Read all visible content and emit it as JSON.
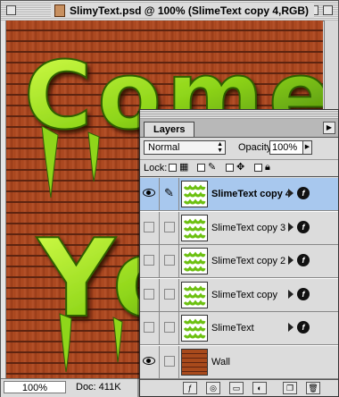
{
  "window": {
    "title": "SlimyText.psd @ 100% (SlimeText copy 4,RGB)"
  },
  "canvas": {
    "art_text_lines": [
      "Come",
      "You"
    ],
    "colors": {
      "brick": "#a7441c",
      "mortar": "#5e2410",
      "slime": "#8fd61a"
    }
  },
  "statusbar": {
    "zoom": "100%",
    "doc_info": "Doc: 411K"
  },
  "layers_palette": {
    "tab_label": "Layers",
    "blend_mode": "Normal",
    "opacity_label": "Opacity:",
    "opacity_value": "100%",
    "lock_label": "Lock:",
    "layers": [
      {
        "name": "SlimeText copy 4",
        "visible": true,
        "selected": true,
        "thumb": "slime"
      },
      {
        "name": "SlimeText copy 3",
        "visible": false,
        "selected": false,
        "thumb": "slime"
      },
      {
        "name": "SlimeText copy 2",
        "visible": false,
        "selected": false,
        "thumb": "slime"
      },
      {
        "name": "SlimeText copy",
        "visible": false,
        "selected": false,
        "thumb": "slime"
      },
      {
        "name": "SlimeText",
        "visible": false,
        "selected": false,
        "thumb": "slime"
      },
      {
        "name": "Wall",
        "visible": true,
        "selected": false,
        "thumb": "wall"
      }
    ],
    "bottom_buttons": [
      "layer-style-icon",
      "mask-icon",
      "new-set-icon",
      "adjustment-layer-icon",
      "new-layer-icon",
      "trash-icon"
    ]
  }
}
